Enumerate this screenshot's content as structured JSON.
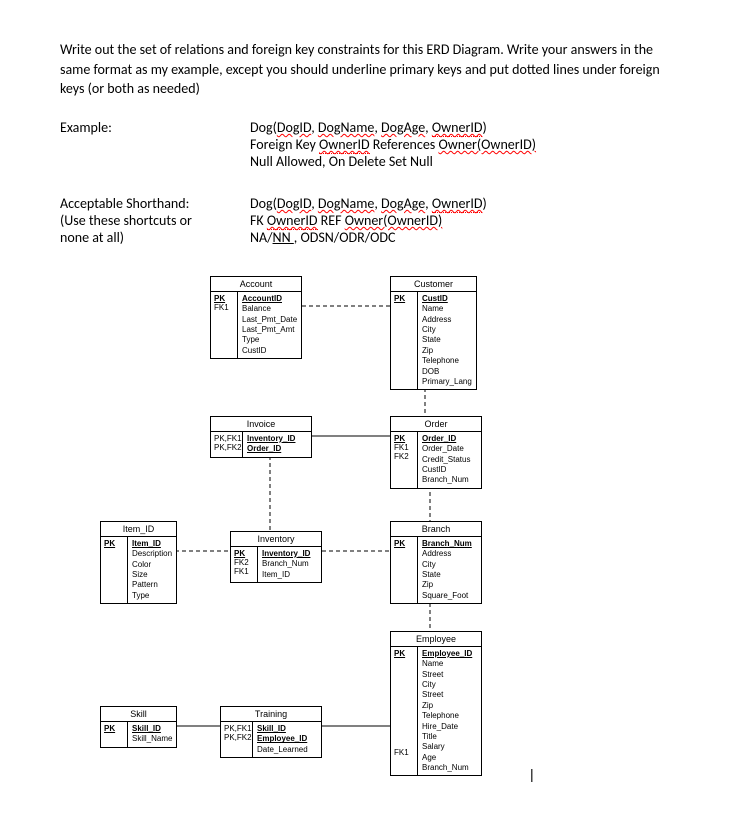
{
  "prompt": "Write out the set of relations and foreign key constraints for this ERD Diagram. Write your answers in the same format as my example, except you should underline primary keys and put dotted lines under foreign keys (or both as needed)",
  "example": {
    "label": "Example:",
    "line1_parts": [
      "Dog(",
      "DogID",
      ", ",
      "DogName",
      ", ",
      "DogAge",
      ", ",
      "OwnerID",
      ")"
    ],
    "line2_pre": "Foreign Key ",
    "line2_fk": "OwnerID",
    "line2_mid": " References ",
    "line2_ref": "Owner(OwnerID)",
    "line3": "Null Allowed, On Delete Set Null"
  },
  "shorthand": {
    "label1": "Acceptable Shorthand:",
    "label2": "(Use these shortcuts or",
    "label3": "none at all)",
    "line1_parts": [
      "Dog(",
      "DogID",
      ", ",
      "DogName",
      ", ",
      "DogAge",
      ", ",
      "OwnerID",
      ")"
    ],
    "line2_pre": "FK ",
    "line2_fk": "OwnerID",
    "line2_mid": " REF ",
    "line2_ref": "Owner(OwnerID)",
    "line3_pre": "NA/",
    "line3_nn": "NN ",
    "line3_post": ", ODSN/ODR/ODC"
  },
  "entities": {
    "account": {
      "title": "Account",
      "keys": [
        "PK",
        "",
        "",
        "",
        "",
        "FK1"
      ],
      "attrs": [
        "AccountID",
        "Balance",
        "Last_Pmt_Date",
        "Last_Pmt_Amt",
        "Type",
        "CustID"
      ]
    },
    "customer": {
      "title": "Customer",
      "keys": [
        "PK",
        "",
        "",
        "",
        "",
        "",
        "",
        "",
        ""
      ],
      "attrs": [
        "CustID",
        "Name",
        "Address",
        "City",
        "State",
        "Zip",
        "Telephone",
        "DOB",
        "Primary_Lang"
      ]
    },
    "invoice": {
      "title": "Invoice",
      "keys": [
        "PK,FK1",
        "PK,FK2"
      ],
      "attrs": [
        "Inventory_ID",
        "Order_ID"
      ]
    },
    "order": {
      "title": "Order",
      "keys": [
        "PK",
        "",
        "",
        "FK1",
        "FK2"
      ],
      "attrs": [
        "Order_ID",
        "Order_Date",
        "Credit_Status",
        "CustID",
        "Branch_Num"
      ]
    },
    "item": {
      "title": "Item_ID",
      "keys": [
        "PK",
        "",
        "",
        "",
        "",
        ""
      ],
      "attrs": [
        "Item_ID",
        "Description",
        "Color",
        "Size",
        "Pattern",
        "Type"
      ]
    },
    "inventory": {
      "title": "Inventory",
      "keys": [
        "PK",
        "FK2",
        "FK1"
      ],
      "attrs": [
        "Inventory_ID",
        "Branch_Num",
        "Item_ID"
      ]
    },
    "branch": {
      "title": "Branch",
      "keys": [
        "PK",
        "",
        "",
        "",
        "",
        ""
      ],
      "attrs": [
        "Branch_Num",
        "Address",
        "City",
        "State",
        "Zip",
        "Square_Foot"
      ]
    },
    "employee": {
      "title": "Employee",
      "keys": [
        "PK",
        "",
        "",
        "",
        "",
        "",
        "",
        "",
        "",
        "",
        "",
        "FK1"
      ],
      "attrs": [
        "Employee_ID",
        "Name",
        "Street",
        "City",
        "Street",
        "Zip",
        "Telephone",
        "Hire_Date",
        "Title",
        "Salary",
        "Age",
        "Branch_Num"
      ]
    },
    "skill": {
      "title": "Skill",
      "keys": [
        "PK",
        ""
      ],
      "attrs": [
        "Skill_ID",
        "Skill_Name"
      ]
    },
    "training": {
      "title": "Training",
      "keys": [
        "PK,FK1",
        "PK,FK2",
        ""
      ],
      "attrs": [
        "Skill_ID",
        "Employee_ID",
        "Date_Learned"
      ]
    }
  }
}
